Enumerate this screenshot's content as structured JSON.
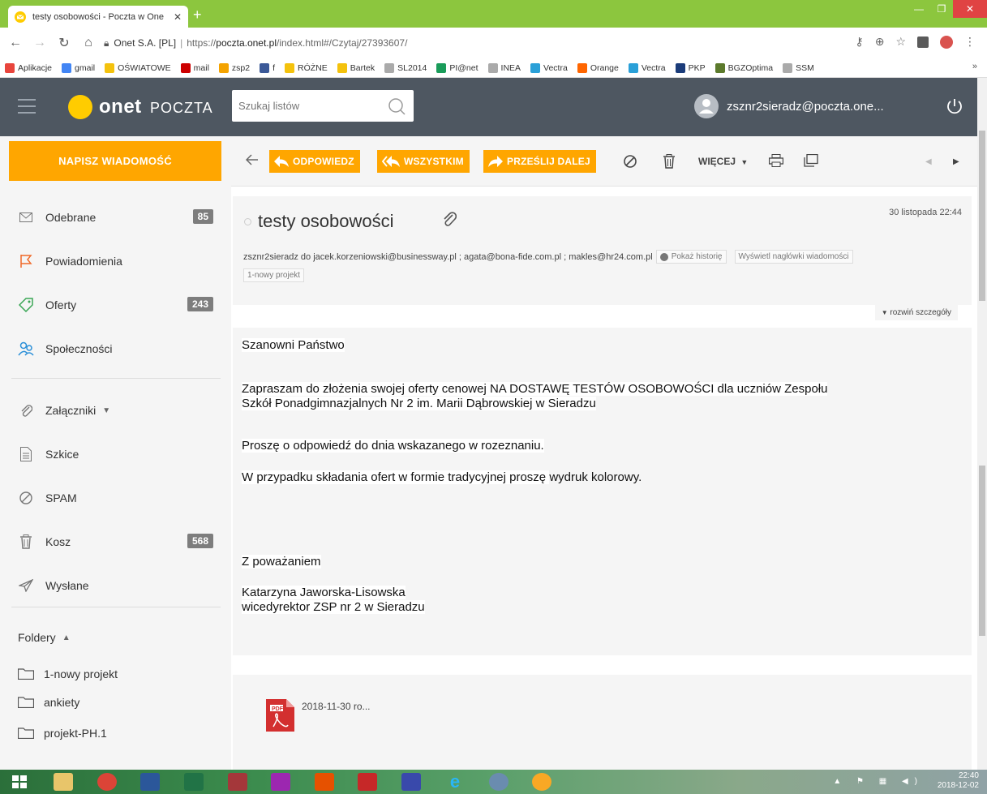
{
  "browser": {
    "tab_title": "testy osobowości - Poczta w One",
    "url_host": "Onet S.A. [PL]",
    "url_sep": "|",
    "url_prefix": "https://",
    "url_domain": "poczta.onet.pl",
    "url_path": "/index.html#/Czytaj/27393607/"
  },
  "bookmarks": [
    {
      "label": "Aplikacje",
      "color": "#e8453c"
    },
    {
      "label": "gmail",
      "color": "#4285f4"
    },
    {
      "label": "OŚWIATOWE",
      "color": "#f4c20d"
    },
    {
      "label": "mail",
      "color": "#cc0000"
    },
    {
      "label": "zsp2",
      "color": "#f4a300"
    },
    {
      "label": "f",
      "color": "#3b5998"
    },
    {
      "label": "RÓŻNE",
      "color": "#f4c20d"
    },
    {
      "label": "Bartek",
      "color": "#f4c20d"
    },
    {
      "label": "SL2014",
      "color": "#aaaaaa"
    },
    {
      "label": "PI@net",
      "color": "#1a9c5a"
    },
    {
      "label": "INEA",
      "color": "#aaaaaa"
    },
    {
      "label": "Vectra",
      "color": "#2aa0d8"
    },
    {
      "label": "Orange",
      "color": "#ff6600"
    },
    {
      "label": "Vectra",
      "color": "#2aa0d8"
    },
    {
      "label": "PKP",
      "color": "#1b3c7a"
    },
    {
      "label": "BGZOptima",
      "color": "#5c7a2c"
    },
    {
      "label": "SSM",
      "color": "#aaaaaa"
    }
  ],
  "bookmarks_more": "»",
  "header": {
    "logo": "onet",
    "logo_sub": "POCZTA",
    "search_placeholder": "Szukaj listów",
    "user_email": "zsznr2sieradz@poczta.one..."
  },
  "sidebar": {
    "compose": "NAPISZ WIADOMOŚĆ",
    "items": [
      {
        "label": "Odebrane",
        "badge": "85"
      },
      {
        "label": "Powiadomienia",
        "badge": ""
      },
      {
        "label": "Oferty",
        "badge": "243"
      },
      {
        "label": "Społeczności",
        "badge": ""
      },
      {
        "label": "Załączniki",
        "badge": ""
      },
      {
        "label": "Szkice",
        "badge": ""
      },
      {
        "label": "SPAM",
        "badge": ""
      },
      {
        "label": "Kosz",
        "badge": "568"
      },
      {
        "label": "Wysłane",
        "badge": ""
      }
    ],
    "folders_label": "Foldery",
    "folders": [
      "1-nowy projekt",
      "ankiety",
      "projekt-PH.1"
    ]
  },
  "toolbar": {
    "reply": "ODPOWIEDZ",
    "reply_all": "WSZYSTKIM",
    "forward": "PRZEŚLIJ DALEJ",
    "more": "WIĘCEJ"
  },
  "message": {
    "subject": "testy osobowości",
    "date": "30 listopada 22:44",
    "recipients": "zsznr2sieradz do jacek.korzeniowski@businessway.pl ; agata@bona-fide.com.pl ; makles@hr24.com.pl",
    "history": "Pokaż historię",
    "headers": "Wyświetl nagłówki wiadomości",
    "tag": "1-nowy projekt",
    "details": "rozwiń szczegóły",
    "body": {
      "greeting": "Szanowni Państwo",
      "p1_line1": "Zapraszam do złożenia swojej oferty cenowej NA DOSTAWĘ TESTÓW OSOBOWOŚCI dla uczniów Zespołu",
      "p1_line2": "Szkół Ponadgimnazjalnych Nr 2 im. Marii Dąbrowskiej w Sieradzu",
      "p2": "Proszę o odpowiedź do dnia wskazanego w rozeznaniu.",
      "p3_a": "W przypadku składania ofert w formie tradycyjnej proszę ",
      "p3_b": "wydruk kolorowy.",
      "closing": "Z poważaniem",
      "signer": "Katarzyna Jaworska-Lisowska",
      "role": "wicedyrektor ZSP nr 2 w Sieradzu"
    },
    "attachment": "2018-11-30 ro..."
  },
  "taskbar": {
    "time": "22:40",
    "date": "2018-12-02"
  }
}
